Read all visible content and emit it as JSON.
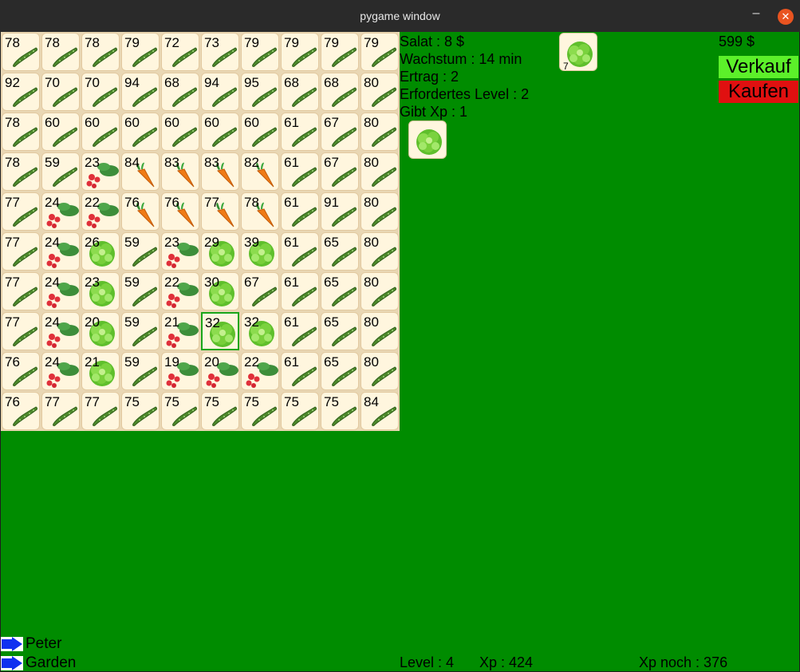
{
  "window": {
    "title": "pygame window",
    "minimize": "–",
    "close": "✕"
  },
  "colors": {
    "field": "#008c00",
    "sell": "#5cf02a",
    "buy": "#e01010",
    "selection": "#1aa61a",
    "nav_arrow": "#1030f0"
  },
  "grid": {
    "cols": 10,
    "selected": {
      "row": 7,
      "col": 5
    },
    "rows": [
      [
        {
          "v": "78",
          "c": "cucumber"
        },
        {
          "v": "78",
          "c": "cucumber"
        },
        {
          "v": "78",
          "c": "cucumber"
        },
        {
          "v": "79",
          "c": "cucumber"
        },
        {
          "v": "72",
          "c": "cucumber"
        },
        {
          "v": "73",
          "c": "cucumber"
        },
        {
          "v": "79",
          "c": "cucumber"
        },
        {
          "v": "79",
          "c": "cucumber"
        },
        {
          "v": "79",
          "c": "cucumber"
        },
        {
          "v": "79",
          "c": "cucumber"
        }
      ],
      [
        {
          "v": "92",
          "c": "cucumber"
        },
        {
          "v": "70",
          "c": "cucumber"
        },
        {
          "v": "70",
          "c": "cucumber"
        },
        {
          "v": "94",
          "c": "cucumber"
        },
        {
          "v": "68",
          "c": "cucumber"
        },
        {
          "v": "94",
          "c": "cucumber"
        },
        {
          "v": "95",
          "c": "cucumber"
        },
        {
          "v": "68",
          "c": "cucumber"
        },
        {
          "v": "68",
          "c": "cucumber"
        },
        {
          "v": "80",
          "c": "cucumber"
        }
      ],
      [
        {
          "v": "78",
          "c": "cucumber"
        },
        {
          "v": "60",
          "c": "cucumber"
        },
        {
          "v": "60",
          "c": "cucumber"
        },
        {
          "v": "60",
          "c": "cucumber"
        },
        {
          "v": "60",
          "c": "cucumber"
        },
        {
          "v": "60",
          "c": "cucumber"
        },
        {
          "v": "60",
          "c": "cucumber"
        },
        {
          "v": "61",
          "c": "cucumber"
        },
        {
          "v": "67",
          "c": "cucumber"
        },
        {
          "v": "80",
          "c": "cucumber"
        }
      ],
      [
        {
          "v": "78",
          "c": "cucumber"
        },
        {
          "v": "59",
          "c": "cucumber"
        },
        {
          "v": "23",
          "c": "radish"
        },
        {
          "v": "84",
          "c": "carrot"
        },
        {
          "v": "83",
          "c": "carrot"
        },
        {
          "v": "83",
          "c": "carrot"
        },
        {
          "v": "82",
          "c": "carrot"
        },
        {
          "v": "61",
          "c": "cucumber"
        },
        {
          "v": "67",
          "c": "cucumber"
        },
        {
          "v": "80",
          "c": "cucumber"
        }
      ],
      [
        {
          "v": "77",
          "c": "cucumber"
        },
        {
          "v": "24",
          "c": "radish"
        },
        {
          "v": "22",
          "c": "radish"
        },
        {
          "v": "76",
          "c": "carrot"
        },
        {
          "v": "76",
          "c": "carrot"
        },
        {
          "v": "77",
          "c": "carrot"
        },
        {
          "v": "78",
          "c": "carrot"
        },
        {
          "v": "61",
          "c": "cucumber"
        },
        {
          "v": "91",
          "c": "cucumber"
        },
        {
          "v": "80",
          "c": "cucumber"
        }
      ],
      [
        {
          "v": "77",
          "c": "cucumber"
        },
        {
          "v": "24",
          "c": "radish"
        },
        {
          "v": "26",
          "c": "lettuce"
        },
        {
          "v": "59",
          "c": "cucumber"
        },
        {
          "v": "23",
          "c": "radish"
        },
        {
          "v": "29",
          "c": "lettuce"
        },
        {
          "v": "39",
          "c": "lettuce"
        },
        {
          "v": "61",
          "c": "cucumber"
        },
        {
          "v": "65",
          "c": "cucumber"
        },
        {
          "v": "80",
          "c": "cucumber"
        }
      ],
      [
        {
          "v": "77",
          "c": "cucumber"
        },
        {
          "v": "24",
          "c": "radish"
        },
        {
          "v": "23",
          "c": "lettuce"
        },
        {
          "v": "59",
          "c": "cucumber"
        },
        {
          "v": "22",
          "c": "radish"
        },
        {
          "v": "30",
          "c": "lettuce"
        },
        {
          "v": "67",
          "c": "cucumber"
        },
        {
          "v": "61",
          "c": "cucumber"
        },
        {
          "v": "65",
          "c": "cucumber"
        },
        {
          "v": "80",
          "c": "cucumber"
        }
      ],
      [
        {
          "v": "77",
          "c": "cucumber"
        },
        {
          "v": "24",
          "c": "radish"
        },
        {
          "v": "20",
          "c": "lettuce"
        },
        {
          "v": "59",
          "c": "cucumber"
        },
        {
          "v": "21",
          "c": "radish"
        },
        {
          "v": "32",
          "c": "lettuce"
        },
        {
          "v": "32",
          "c": "lettuce"
        },
        {
          "v": "61",
          "c": "cucumber"
        },
        {
          "v": "65",
          "c": "cucumber"
        },
        {
          "v": "80",
          "c": "cucumber"
        }
      ],
      [
        {
          "v": "76",
          "c": "cucumber"
        },
        {
          "v": "24",
          "c": "radish"
        },
        {
          "v": "21",
          "c": "lettuce"
        },
        {
          "v": "59",
          "c": "cucumber"
        },
        {
          "v": "19",
          "c": "radish"
        },
        {
          "v": "20",
          "c": "radish"
        },
        {
          "v": "22",
          "c": "radish"
        },
        {
          "v": "61",
          "c": "cucumber"
        },
        {
          "v": "65",
          "c": "cucumber"
        },
        {
          "v": "80",
          "c": "cucumber"
        }
      ],
      [
        {
          "v": "76",
          "c": "cucumber"
        },
        {
          "v": "77",
          "c": "cucumber"
        },
        {
          "v": "77",
          "c": "cucumber"
        },
        {
          "v": "75",
          "c": "cucumber"
        },
        {
          "v": "75",
          "c": "cucumber"
        },
        {
          "v": "75",
          "c": "cucumber"
        },
        {
          "v": "75",
          "c": "cucumber"
        },
        {
          "v": "75",
          "c": "cucumber"
        },
        {
          "v": "75",
          "c": "cucumber"
        },
        {
          "v": "84",
          "c": "cucumber"
        }
      ]
    ]
  },
  "crop_info": {
    "lines": [
      "Salat : 8 $",
      "Wachstum : 14 min",
      "Ertrag : 2",
      "Erfordertes Level : 2",
      "Gibt Xp : 1"
    ]
  },
  "inventory": {
    "crop": "lettuce",
    "count": "7"
  },
  "selected_seed": {
    "crop": "lettuce"
  },
  "money": "599 $",
  "buttons": {
    "sell": "Verkauf",
    "buy": "Kaufen"
  },
  "nav": [
    {
      "label": "Peter"
    },
    {
      "label": "Garden"
    }
  ],
  "status": {
    "level": "Level : 4",
    "xp": "Xp : 424",
    "xp_left": "Xp noch : 376"
  }
}
